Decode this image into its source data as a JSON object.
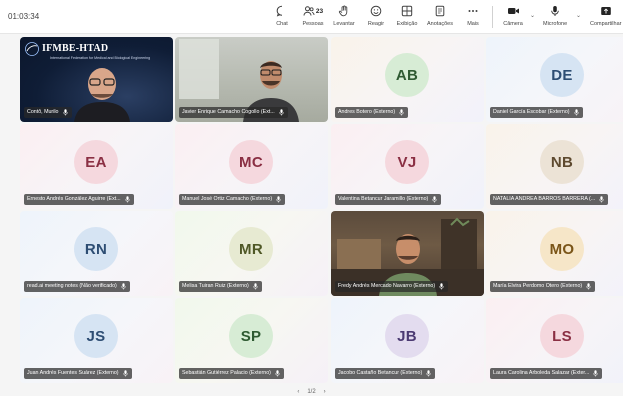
{
  "meeting": {
    "timer": "01:03:34"
  },
  "toolbar": {
    "chat": "Chat",
    "people": "Pessoas",
    "people_count": "23",
    "raise": "Levantar",
    "react": "Reagir",
    "view": "Exibição",
    "notes": "Anotações",
    "more": "Mais",
    "camera": "Câmera",
    "mic": "Microfone",
    "share": "Compartilhar"
  },
  "ifmbe": {
    "logo": "IFMBE-HTAD",
    "subtitle": "International Federation for Medical and Biological Engineering"
  },
  "participants": [
    {
      "name": "Contô, Murilo",
      "video": "ifmbe"
    },
    {
      "name": "Javier Enrique Camacho Cogollo (Ext...",
      "video": "room"
    },
    {
      "name": "Andres Botero (Externo)",
      "initials": "AB",
      "avatar_bg": "#d7ecd5",
      "avatar_fg": "#2f5a32",
      "tile": "t-warm"
    },
    {
      "name": "Daniel García Escobar (Externo)",
      "initials": "DE",
      "avatar_bg": "#d6e4f3",
      "avatar_fg": "#2d4d73",
      "tile": "t-blue"
    },
    {
      "name": "Ernesto Andrés González Aguirre (Ext...",
      "initials": "EA",
      "avatar_bg": "#f5d8de",
      "avatar_fg": "#8a2f43",
      "tile": "t-pink"
    },
    {
      "name": "Manuel José Ortiz Camacho (Externo)",
      "initials": "MC",
      "avatar_bg": "#f5d8de",
      "avatar_fg": "#8a2f43",
      "tile": "t-pink"
    },
    {
      "name": "Valentina Betancur Jaramillo (Externo)",
      "initials": "VJ",
      "avatar_bg": "#f5d8de",
      "avatar_fg": "#8a2f43",
      "tile": "t-pink"
    },
    {
      "name": "NATALIA ANDREA BARROS BARRERA (...",
      "initials": "NB",
      "avatar_bg": "#ece3d6",
      "avatar_fg": "#5e4a2f",
      "tile": "t-warm"
    },
    {
      "name": "read.ai meeting notes (Não verificado)",
      "initials": "RN",
      "avatar_bg": "#d6e4f3",
      "avatar_fg": "#2d4d73",
      "tile": "t-blue"
    },
    {
      "name": "Melisa Tuiran Ruiz (Externo)",
      "initials": "MR",
      "avatar_bg": "#e7ead2",
      "avatar_fg": "#4f5826",
      "tile": "t-green"
    },
    {
      "name": "Fredy Andrés Mercado Navarro (Externo)",
      "video": "living"
    },
    {
      "name": "María Elvira Perdomo Otero (Externo)",
      "initials": "MO",
      "avatar_bg": "#f6e6c8",
      "avatar_fg": "#7a5518",
      "tile": "t-warm"
    },
    {
      "name": "Juan Andrés Fuentes Suárez (Externo)",
      "initials": "JS",
      "avatar_bg": "#d6e4f3",
      "avatar_fg": "#2d4d73",
      "tile": "t-blue"
    },
    {
      "name": "Sebastián Gutiérrez Palacio (Externo)",
      "initials": "SP",
      "avatar_bg": "#d7ecd5",
      "avatar_fg": "#2f5a32",
      "tile": "t-green"
    },
    {
      "name": "Jacobo Castaño Betancur (Externo)",
      "initials": "JB",
      "avatar_bg": "#e3dcef",
      "avatar_fg": "#4b3a72",
      "tile": "t-blue"
    },
    {
      "name": "Laura Carolina Arboleda Salazar (Exter...",
      "initials": "LS",
      "avatar_bg": "#f5d8de",
      "avatar_fg": "#8a2f43",
      "tile": "t-pink"
    }
  ],
  "pager": {
    "page": "1/2"
  }
}
